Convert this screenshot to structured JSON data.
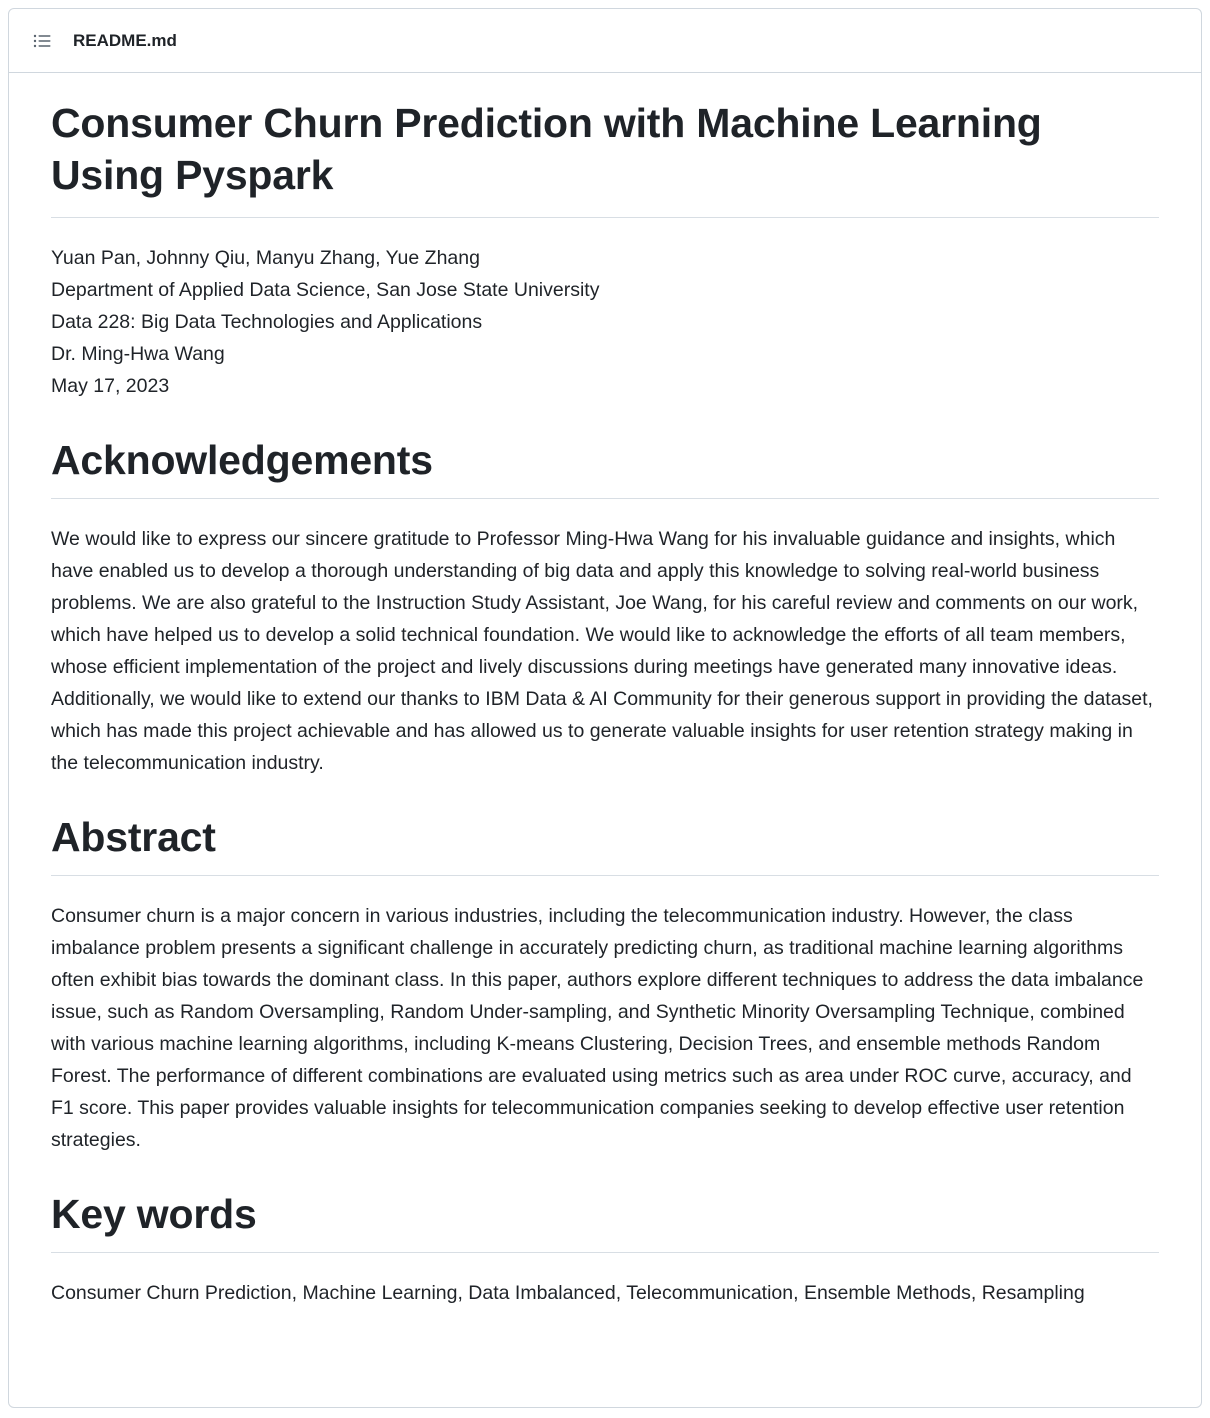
{
  "header": {
    "filename": "README.md",
    "outline_icon": "list-unordered-icon"
  },
  "readme": {
    "title": "Consumer Churn Prediction with Machine Learning Using Pyspark",
    "meta": [
      "Yuan Pan, Johnny Qiu, Manyu Zhang, Yue Zhang",
      "Department of Applied Data Science, San Jose State University",
      "Data 228: Big Data Technologies and Applications",
      "Dr. Ming-Hwa Wang",
      "May 17, 2023"
    ],
    "sections": [
      {
        "heading": "Acknowledgements",
        "text": "We would like to express our sincere gratitude to Professor Ming-Hwa Wang for his invaluable guidance and insights, which have enabled us to develop a thorough understanding of big data and apply this knowledge to solving real-world business problems. We are also grateful to the Instruction Study Assistant, Joe Wang, for his careful review and comments on our work, which have helped us to develop a solid technical foundation. We would like to acknowledge the efforts of all team members, whose efficient implementation of the project and lively discussions during meetings have generated many innovative ideas. Additionally, we would like to extend our thanks to IBM Data & AI Community for their generous support in providing the dataset, which has made this project achievable and has allowed us to generate valuable insights for user retention strategy making in the telecommunication industry."
      },
      {
        "heading": "Abstract",
        "text": "Consumer churn is a major concern in various industries, including the telecommunication industry. However, the class imbalance problem presents a significant challenge in accurately predicting churn, as traditional machine learning algorithms often exhibit bias towards the dominant class. In this paper, authors explore different techniques to address the data imbalance issue, such as Random Oversampling, Random Under-sampling, and Synthetic Minority Oversampling Technique, combined with various machine learning algorithms, including K-means Clustering, Decision Trees, and ensemble methods Random Forest. The performance of different combinations are evaluated using metrics such as area under ROC curve, accuracy, and F1 score. This paper provides valuable insights for telecommunication companies seeking to develop effective user retention strategies."
      },
      {
        "heading": "Key words",
        "text": "Consumer Churn Prediction, Machine Learning, Data Imbalanced, Telecommunication, Ensemble Methods, Resampling"
      }
    ]
  },
  "colors": {
    "text": "#1f2328",
    "border": "#d0d7de",
    "icon": "#59636e"
  }
}
